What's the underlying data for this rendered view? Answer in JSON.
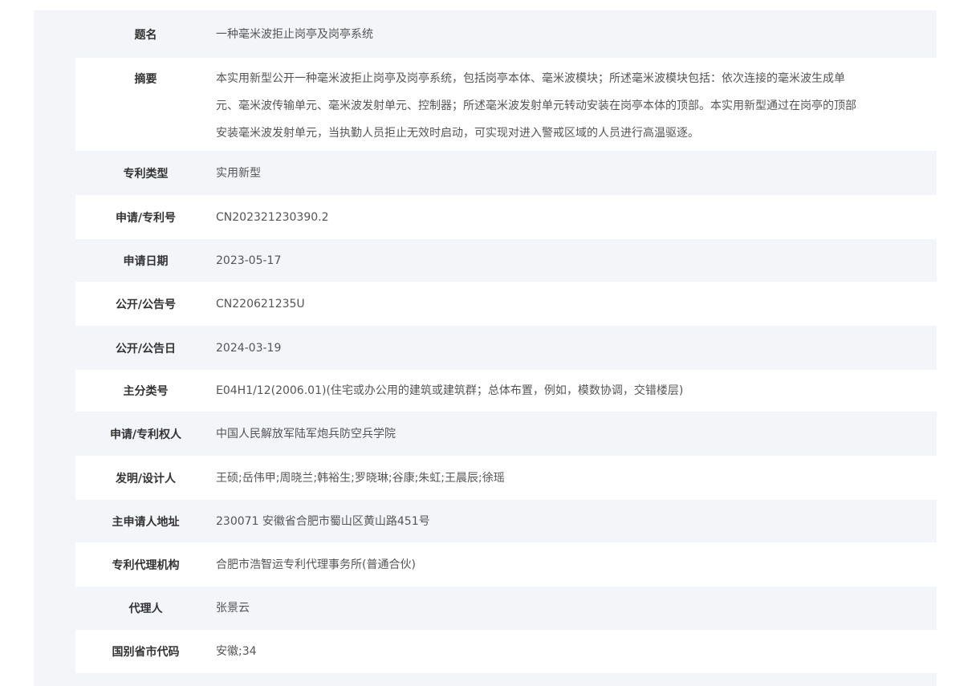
{
  "rows": [
    {
      "label": "题名",
      "value": "一种毫米波拒止岗亭及岗亭系统"
    },
    {
      "label": "摘要",
      "value": "本实用新型公开一种毫米波拒止岗亭及岗亭系统，包括岗亭本体、毫米波模块；所述毫米波模块包括：依次连接的毫米波生成单元、毫米波传输单元、毫米波发射单元、控制器；所述毫米波发射单元转动安装在岗亭本体的顶部。本实用新型通过在岗亭的顶部安装毫米波发射单元，当执勤人员拒止无效时启动，可实现对进入警戒区域的人员进行高温驱逐。"
    },
    {
      "label": "专利类型",
      "value": "实用新型"
    },
    {
      "label": "申请/专利号",
      "value": "CN202321230390.2"
    },
    {
      "label": "申请日期",
      "value": "2023-05-17"
    },
    {
      "label": "公开/公告号",
      "value": "CN220621235U"
    },
    {
      "label": "公开/公告日",
      "value": "2024-03-19"
    },
    {
      "label": "主分类号",
      "value": "E04H1/12(2006.01)(住宅或办公用的建筑或建筑群；总体布置，例如，模数协调，交错楼层)"
    },
    {
      "label": "申请/专利权人",
      "value": "中国人民解放军陆军炮兵防空兵学院"
    },
    {
      "label": "发明/设计人",
      "value": "王硕;岳伟甲;周晓兰;韩裕生;罗晓琳;谷康;朱虹;王晨辰;徐瑶"
    },
    {
      "label": "主申请人地址",
      "value": "230071 安徽省合肥市蜀山区黄山路451号"
    },
    {
      "label": "专利代理机构",
      "value": "合肥市浩智运专利代理事务所(普通合伙)"
    },
    {
      "label": "代理人",
      "value": "张景云"
    },
    {
      "label": "国别省市代码",
      "value": "安徽;34"
    }
  ]
}
